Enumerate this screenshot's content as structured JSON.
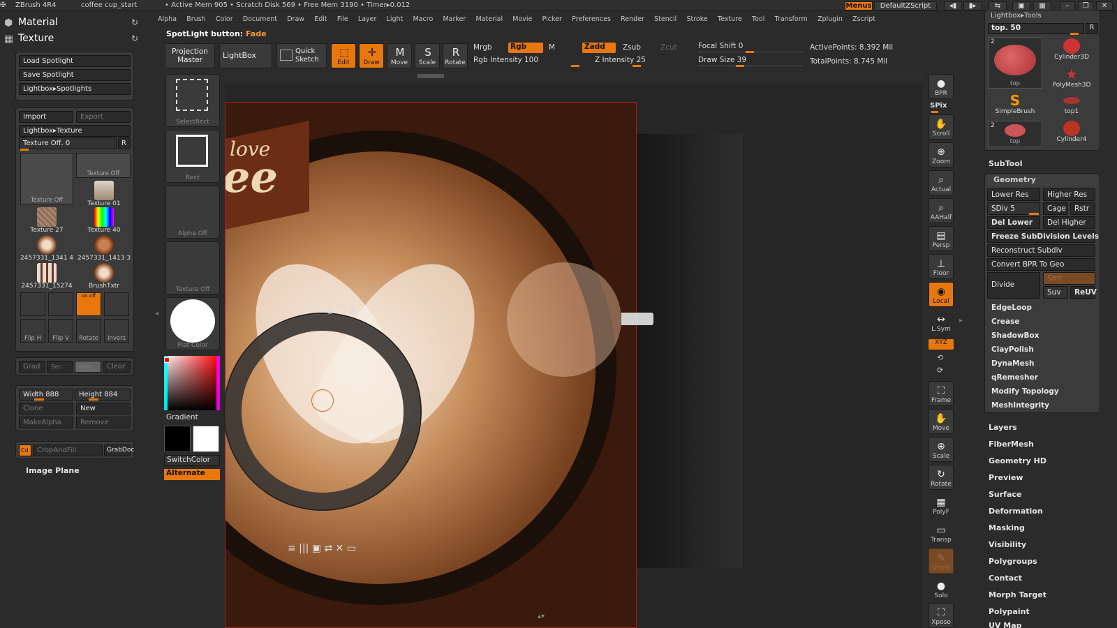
{
  "titlebar": {
    "app": "ZBrush 4R4",
    "doc": "coffee cup_start",
    "stats": "• Active Mem 905 • Scratch Disk 569 • Free Mem 3190 • Timer▸0.012",
    "menus": "Menus",
    "script": "DefaultZScript"
  },
  "menubar": [
    "Alpha",
    "Brush",
    "Color",
    "Document",
    "Draw",
    "Edit",
    "File",
    "Layer",
    "Light",
    "Macro",
    "Marker",
    "Material",
    "Movie",
    "Picker",
    "Preferences",
    "Render",
    "Stencil",
    "Stroke",
    "Texture",
    "Tool",
    "Transform",
    "Zplugin",
    "Zscript"
  ],
  "spotlight": {
    "label": "SpotLight button:",
    "value": "Fade"
  },
  "leftpanel": {
    "material": "Material",
    "texture": "Texture",
    "load_spotlight": "Load Spotlight",
    "save_spotlight": "Save Spotlight",
    "lightbox_spotlights": "Lightbox▸Spotlights",
    "import": "Import",
    "export": "Export",
    "lightbox_texture": "Lightbox▸Texture",
    "texture_off": "Texture Off. 0",
    "r": "R",
    "textures": [
      {
        "label": "Texture Off",
        "color": "#4a4a4a"
      },
      {
        "label": "Texture Off",
        "color": "#4a4a4a"
      },
      {
        "label": "Texture 01",
        "color": "#b9a58f"
      },
      {
        "label": "Texture 27",
        "color": "#9a7b66"
      },
      {
        "label": "Texture 40",
        "color": "#7fd0ff"
      },
      {
        "label": "2457331_1341 4",
        "color": "#8a4a26"
      },
      {
        "label": "2457331_1413 3",
        "color": "#8a4a26"
      },
      {
        "label": "2457331_15274",
        "color": "#c9b9a9"
      },
      {
        "label": "BrushTxtr",
        "color": "#8a4a26"
      }
    ],
    "onoff": "on off",
    "fliph": "Flip H",
    "flipv": "Flip V",
    "rotate": "Rotate",
    "invers": "Invers",
    "grad": "Grad",
    "sec": "Sec",
    "main": "Main",
    "clear": "Clear",
    "width": "Width 888",
    "height": "Height 884",
    "clone": "Clone",
    "new": "New",
    "makealpha": "MakeAlpha",
    "remove": "Remove",
    "cd": "Cd",
    "cropandfill": "CropAndFill",
    "grabdoc": "GrabDoc",
    "imageplane": "Image Plane"
  },
  "toolbar": {
    "projection_master": "Projection Master",
    "lightbox": "LightBox",
    "quick_sketch": "Quick Sketch",
    "edit": "Edit",
    "draw": "Draw",
    "move": "Move",
    "scale": "Scale",
    "rotate": "Rotate",
    "mrgb": "Mrgb",
    "rgb": "Rgb",
    "m": "M",
    "rgb_intensity": "Rgb Intensity 100",
    "zadd": "Zadd",
    "zsub": "Zsub",
    "zcut": "Zcut",
    "z_intensity": "Z Intensity 25",
    "focal_shift": "Focal Shift 0",
    "draw_size": "Draw Size 39",
    "active_points": "ActivePoints: 8.392 Mil",
    "total_points": "TotalPoints: 8.745 Mil"
  },
  "leftcol": {
    "selectrect": "SelectRect",
    "rect": "Rect",
    "alpha_off": "Alpha Off",
    "texture_off": "Texture Off",
    "flat_color": "Flat Color",
    "gradient": "Gradient",
    "switchcolor": "SwitchColor",
    "alternate": "Alternate"
  },
  "righttools": [
    "BPR",
    "SPix",
    "Scroll",
    "Zoom",
    "Actual",
    "AAHalf",
    "Persp",
    "Floor",
    "Local",
    "L.Sym",
    "XYZ",
    "Frame",
    "Move",
    "Scale",
    "Rotate",
    "PolyF",
    "Transp",
    "Ghost",
    "Solo",
    "Xpose"
  ],
  "rightpanel": {
    "header": "Lightbox▸Tools",
    "top50": "top. 50",
    "r": "R",
    "tools": [
      {
        "label": "top",
        "badge": "2"
      },
      {
        "label": "Cylinder3D"
      },
      {
        "label": "PolyMesh3D"
      },
      {
        "label": "SimpleBrush"
      },
      {
        "label": "top1"
      },
      {
        "label": "top",
        "badge": "2"
      },
      {
        "label": "Cylinder4"
      }
    ],
    "subtool": "SubTool",
    "geometry": "Geometry",
    "lower_res": "Lower Res",
    "higher_res": "Higher Res",
    "sdiv": "SDiv 5",
    "cage": "Cage",
    "rstr": "Rstr",
    "del_lower": "Del Lower",
    "del_higher": "Del Higher",
    "freeze": "Freeze SubDivision Levels",
    "reconstruct": "Reconstruct Subdiv",
    "convert": "Convert BPR To Geo",
    "divide": "Divide",
    "smt": "Smt",
    "suv": "Suv",
    "reuv": "ReUV",
    "edgeloop": "EdgeLoop",
    "crease": "Crease",
    "shadowbox": "ShadowBox",
    "claypolish": "ClayPolish",
    "dynamesh": "DynaMesh",
    "qremesher": "qRemesher",
    "modify_topology": "Modify Topology",
    "meshintegrity": "MeshIntegrity",
    "sections": [
      "Layers",
      "FiberMesh",
      "Geometry HD",
      "Preview",
      "Surface",
      "Deformation",
      "Masking",
      "Visibility",
      "Polygroups",
      "Contact",
      "Morph Target",
      "Polypaint",
      "UV Map"
    ]
  },
  "colors": {
    "accent": "#e8780e"
  }
}
